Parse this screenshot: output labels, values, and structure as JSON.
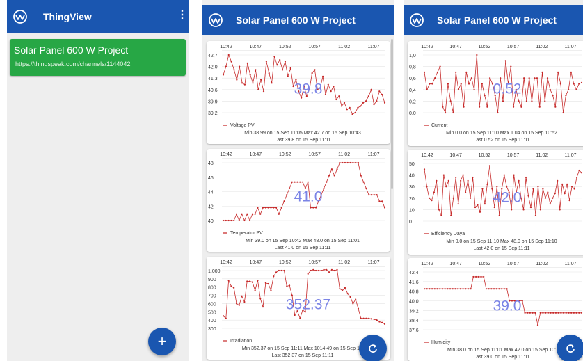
{
  "app": {
    "title": "ThingView",
    "channel": {
      "name": "Solar Panel 600 W Project",
      "url": "https://thingspeak.com/channels/1144042"
    }
  },
  "project_title": "Solar Panel 600 W Project",
  "colors": {
    "appbar": "#1a56b0",
    "channel_card": "#27a745",
    "line": "#c62828",
    "overlay_value": "#7b84e6"
  },
  "icons": {
    "logo": "thingspeak-logo-icon",
    "menu": "more-vert-icon",
    "add": "plus-icon",
    "refresh": "refresh-icon"
  },
  "chart_data": [
    {
      "type": "line",
      "screen": 2,
      "title": "",
      "series": [
        {
          "name": "Voltage PV"
        }
      ],
      "time_ticks": [
        "10:42",
        "10:47",
        "10:52",
        "10:57",
        "11:02",
        "11:07"
      ],
      "y_ticks": [
        "42,7",
        "42,0",
        "41,3",
        "40,6",
        "39,9",
        "39,2"
      ],
      "ylim": [
        39.2,
        42.7
      ],
      "time_range": [
        10.43,
        11.11
      ],
      "values": [
        41.5,
        42.0,
        42.7,
        42.3,
        41.8,
        41.2,
        42.0,
        41.0,
        40.9,
        42.2,
        41.5,
        41.0,
        41.8,
        40.6,
        41.2,
        40.5,
        42.3,
        41.6,
        41.0,
        42.6,
        42.1,
        42.4,
        41.8,
        42.3,
        41.4,
        41.9,
        40.8,
        41.2,
        40.5,
        40.1,
        40.8,
        40.2,
        40.6,
        41.6,
        41.8,
        40.6,
        40.7,
        41.4,
        40.3,
        40.9,
        40.5,
        40.8,
        40.0,
        40.2,
        39.6,
        39.8,
        39.4,
        39.5,
        39.1,
        39.2,
        39.5,
        39.6,
        39.8,
        39.9,
        40.2,
        40.6,
        39.7,
        39.9,
        40.5,
        40.3,
        39.8
      ],
      "current": "39.8",
      "min_line": "Min  38.99 on 15 Sep 11:05   Max  42.7 on 15 Sep 10:43",
      "last_line": "Last  39.8 on 15 Sep 11:11"
    },
    {
      "type": "line",
      "screen": 2,
      "title": "",
      "series": [
        {
          "name": "Temperatur PV"
        }
      ],
      "time_ticks": [
        "10:42",
        "10:47",
        "10:52",
        "10:57",
        "11:02",
        "11:07"
      ],
      "y_ticks": [
        "48",
        "46",
        "44",
        "42",
        "40"
      ],
      "ylim": [
        39.0,
        48.0
      ],
      "time_range": [
        10.43,
        11.11
      ],
      "values": [
        39.0,
        39.0,
        39.0,
        39.0,
        39.0,
        40.0,
        39.0,
        40.0,
        39.0,
        40.0,
        39.0,
        40.0,
        40.0,
        41.0,
        40.0,
        41.0,
        41.0,
        41.0,
        41.0,
        41.0,
        41.0,
        40.0,
        41.0,
        42.0,
        43.0,
        44.0,
        45.0,
        45.0,
        45.0,
        45.0,
        45.0,
        44.0,
        45.0,
        41.0,
        41.0,
        41.0,
        42.0,
        43.0,
        44.0,
        45.0,
        46.0,
        47.0,
        46.0,
        47.0,
        48.0,
        48.0,
        48.0,
        48.0,
        48.0,
        48.0,
        48.0,
        48.0,
        46.0,
        45.0,
        44.0,
        43.0,
        43.0,
        43.0,
        43.0,
        42.0,
        42.0,
        41.0
      ],
      "current": "41.0",
      "min_line": "Min  39.0 on 15 Sep 10:42   Max  48.0 on 15 Sep 11:01",
      "last_line": "Last  41.0 on 15 Sep 11:11"
    },
    {
      "type": "line",
      "screen": 2,
      "title": "",
      "series": [
        {
          "name": "Irradiation"
        }
      ],
      "time_ticks": [
        "10:42",
        "10:47",
        "10:52",
        "10:57",
        "11:02",
        "11:07"
      ],
      "y_ticks": [
        "1.000",
        "900",
        "800",
        "700",
        "600",
        "500",
        "400",
        "300"
      ],
      "ylim": [
        300,
        1000
      ],
      "time_range": [
        10.43,
        11.11
      ],
      "values": [
        450,
        420,
        880,
        810,
        790,
        600,
        580,
        690,
        620,
        870,
        870,
        860,
        760,
        880,
        660,
        560,
        850,
        840,
        760,
        930,
        980,
        1000,
        1000,
        1000,
        810,
        820,
        700,
        460,
        510,
        420,
        520,
        500,
        960,
        1000,
        1010,
        1000,
        1000,
        1000,
        1010,
        1010,
        980,
        1010,
        1000,
        1010,
        780,
        760,
        790,
        720,
        680,
        600,
        650,
        540,
        420,
        420,
        420,
        420,
        415,
        410,
        400,
        380,
        370,
        352
      ],
      "current": "352.37",
      "min_line": "Min  352.37 on 15 Sep 11:11   Max  1014.49 on 15 Sep 11:",
      "last_line": "Last  352.37 on 15 Sep 11:11"
    },
    {
      "type": "line",
      "screen": 3,
      "title": "",
      "series": [
        {
          "name": "Current"
        }
      ],
      "time_ticks": [
        "10:42",
        "10:47",
        "10:52",
        "10:57",
        "11:02",
        "11:07"
      ],
      "y_ticks": [
        "1,0",
        "0,8",
        "0,6",
        "0,4",
        "0,2",
        "0,0"
      ],
      "ylim": [
        0.0,
        1.0
      ],
      "time_range": [
        10.43,
        11.11
      ],
      "values": [
        0.7,
        0.4,
        0.5,
        0.5,
        0.6,
        0.7,
        0.8,
        0.1,
        0.0,
        0.5,
        0.2,
        0.0,
        0.7,
        0.4,
        0.5,
        0.1,
        0.7,
        0.5,
        0.6,
        0.4,
        1.0,
        0.1,
        0.5,
        0.3,
        0.1,
        0.6,
        0.5,
        0.3,
        0.0,
        0.6,
        0.2,
        0.9,
        0.5,
        0.8,
        0.1,
        0.4,
        0.2,
        0.1,
        0.6,
        0.2,
        0.6,
        0.2,
        0.6,
        0.6,
        0.1,
        0.7,
        0.2,
        0.6,
        0.4,
        0.3,
        0.1,
        0.7,
        0.5,
        0.0,
        0.3,
        0.4,
        0.7,
        0.5,
        0.4,
        0.5,
        0.52
      ],
      "current": "0.52",
      "min_line": "Min  0.0 on 15 Sep 11:10   Max  1.04 on 15 Sep 10:52",
      "last_line": "Last  0.52 on 15 Sep 11:11"
    },
    {
      "type": "line",
      "screen": 3,
      "title": "",
      "series": [
        {
          "name": "Efficiency Daya"
        }
      ],
      "time_ticks": [
        "10:42",
        "10:47",
        "10:52",
        "10:57",
        "11:02",
        "11:07"
      ],
      "y_ticks": [
        "50",
        "40",
        "30",
        "20",
        "10",
        "0"
      ],
      "ylim": [
        0,
        50
      ],
      "time_range": [
        10.43,
        11.11
      ],
      "values": [
        45,
        30,
        20,
        18,
        25,
        35,
        10,
        5,
        40,
        30,
        35,
        5,
        20,
        38,
        15,
        35,
        40,
        25,
        35,
        20,
        38,
        12,
        14,
        8,
        28,
        15,
        32,
        48,
        28,
        12,
        30,
        5,
        28,
        40,
        30,
        25,
        10,
        40,
        25,
        35,
        20,
        10,
        38,
        22,
        12,
        28,
        5,
        30,
        10,
        28,
        20,
        25,
        15,
        20,
        24,
        35,
        10,
        32,
        24,
        32,
        18,
        30,
        28,
        38,
        44,
        42
      ],
      "current": "42.0",
      "min_line": "Min  0.0 on 15 Sep 11:10   Max  48.0 on 15 Sep 11:10",
      "last_line": "Last  42.0 on 15 Sep 11:11"
    },
    {
      "type": "line",
      "screen": 3,
      "title": "",
      "series": [
        {
          "name": "Humidity"
        }
      ],
      "time_ticks": [
        "10:42",
        "10:47",
        "10:52",
        "10:57",
        "11:02",
        "11:07"
      ],
      "y_ticks": [
        "42,4",
        "41,6",
        "40,8",
        "40,0",
        "39,2",
        "38,4",
        "37,6"
      ],
      "ylim": [
        37.6,
        42.4
      ],
      "time_range": [
        10.43,
        11.11
      ],
      "values": [
        41.0,
        41.0,
        41.0,
        41.0,
        41.0,
        41.0,
        41.0,
        41.0,
        41.0,
        41.0,
        41.0,
        41.0,
        41.0,
        41.0,
        41.0,
        41.0,
        41.0,
        41.0,
        41.0,
        42.0,
        42.0,
        42.0,
        42.0,
        42.0,
        41.0,
        41.0,
        41.0,
        41.0,
        41.0,
        41.0,
        41.0,
        41.0,
        41.0,
        40.0,
        40.0,
        40.0,
        40.0,
        40.0,
        40.0,
        39.0,
        39.0,
        39.0,
        39.0,
        39.0,
        38.0,
        39.0,
        39.0,
        39.0,
        39.0,
        39.0,
        39.0,
        39.0,
        39.0,
        39.0,
        39.0,
        39.0,
        39.0,
        39.0,
        39.0,
        39.0,
        39.0,
        39.0
      ],
      "current": "39.0",
      "min_line": "Min  38.0 on 15 Sep 11:01   Max  42.0 on 15 Sep 10:",
      "last_line": "Last  39.0 on 15 Sep 11:11"
    }
  ]
}
